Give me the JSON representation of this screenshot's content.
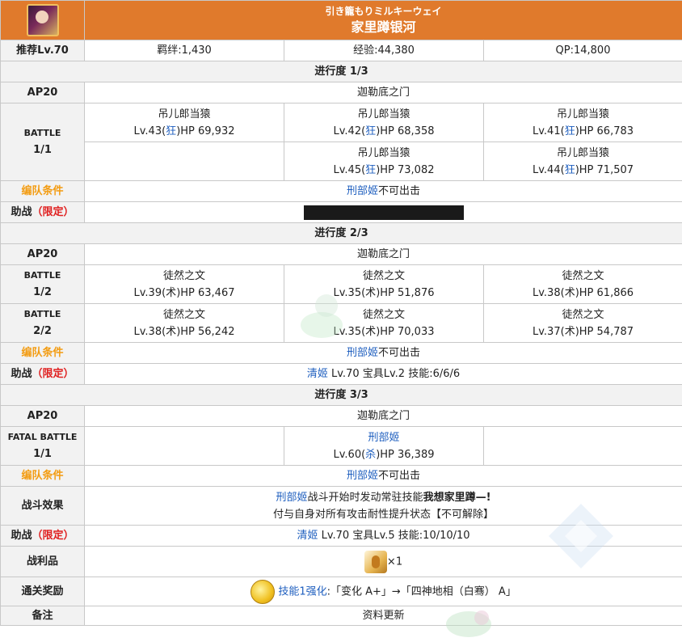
{
  "header": {
    "subtitle": "引き籠もりミルキーウェイ",
    "title": "家里蹲银河"
  },
  "summary": {
    "level": "推荐Lv.70",
    "bond": "羁绊:1,430",
    "exp": "经验:44,380",
    "qp": "QP:14,800"
  },
  "sections": [
    {
      "progress": "进行度 1/3",
      "ap": "AP20",
      "location": "迦勒底之门",
      "battle_label": "BATTLE",
      "battle_num": "1/1",
      "enemies_row1": [
        {
          "name": "吊儿郎当猿",
          "pre": "Lv.43(",
          "cls": "狂",
          "post": ")HP 69,932"
        },
        {
          "name": "吊儿郎当猿",
          "pre": "Lv.42(",
          "cls": "狂",
          "post": ")HP 68,358"
        },
        {
          "name": "吊儿郎当猿",
          "pre": "Lv.41(",
          "cls": "狂",
          "post": ")HP 66,783"
        }
      ],
      "enemies_row2": [
        {
          "name": "吊儿郎当猿",
          "pre": "Lv.45(",
          "cls": "狂",
          "post": ")HP 73,082"
        },
        {
          "name": "吊儿郎当猿",
          "pre": "Lv.44(",
          "cls": "狂",
          "post": ")HP 71,507"
        }
      ],
      "team_label": "编队条件",
      "team_name": "刑部姬",
      "team_text": "不可出击",
      "support_label": "助战",
      "support_limited": "（限定）"
    },
    {
      "progress": "进行度 2/3",
      "ap": "AP20",
      "location": "迦勒底之门",
      "battles": [
        {
          "label": "BATTLE",
          "num": "1/2",
          "enemies": [
            {
              "name": "徒然之文",
              "pre": "Lv.39(",
              "cls": "术",
              "post": ")HP 63,467"
            },
            {
              "name": "徒然之文",
              "pre": "Lv.35(",
              "cls": "术",
              "post": ")HP 51,876"
            },
            {
              "name": "徒然之文",
              "pre": "Lv.38(",
              "cls": "术",
              "post": ")HP 61,866"
            }
          ]
        },
        {
          "label": "BATTLE",
          "num": "2/2",
          "enemies": [
            {
              "name": "徒然之文",
              "pre": "Lv.38(",
              "cls": "术",
              "post": ")HP 56,242"
            },
            {
              "name": "徒然之文",
              "pre": "Lv.35(",
              "cls": "术",
              "post": ")HP 70,033"
            },
            {
              "name": "徒然之文",
              "pre": "Lv.37(",
              "cls": "术",
              "post": ")HP 54,787"
            }
          ]
        }
      ],
      "team_label": "编队条件",
      "team_name": "刑部姬",
      "team_text": "不可出击",
      "support_label": "助战",
      "support_limited": "（限定）",
      "support_name": "清姬",
      "support_detail": " Lv.70 宝具Lv.2 技能:6/6/6"
    },
    {
      "progress": "进行度 3/3",
      "ap": "AP20",
      "location": "迦勒底之门",
      "battle_label": "FATAL BATTLE",
      "battle_num": "1/1",
      "boss": {
        "name": "刑部姬",
        "pre": "Lv.60(",
        "cls": "杀",
        "post": ")HP 36,389"
      },
      "team_label": "编队条件",
      "team_name": "刑部姬",
      "team_text": "不可出击",
      "effect_label": "战斗效果",
      "effect_name": "刑部姬",
      "effect_line1_mid": "战斗开始时发动常驻技能",
      "effect_line1_bold": "我想家里蹲—!",
      "effect_line2": "付与自身对所有攻击耐性提升状态【不可解除】",
      "support_label": "助战",
      "support_limited": "（限定）",
      "support_name": "清姬",
      "support_detail": " Lv.70 宝具Lv.5 技能:10/10/10"
    }
  ],
  "footer": {
    "loot_label": "战利品",
    "loot_count": "×1",
    "reward_label": "通关奖励",
    "reward_skill": "技能1强化",
    "reward_text": ":「变化 A+」→「四神地相（白骞） A」",
    "note_label": "备注",
    "note_text": "资料更新"
  },
  "colors": {
    "header_bg": "#e07a2c",
    "link": "#1f5fbf",
    "orange_label": "#f39c12",
    "red_label": "#e02020"
  },
  "icons": {
    "portrait": "servant-portrait-icon",
    "loot": "material-item-icon",
    "reward": "gold-coin-icon"
  }
}
